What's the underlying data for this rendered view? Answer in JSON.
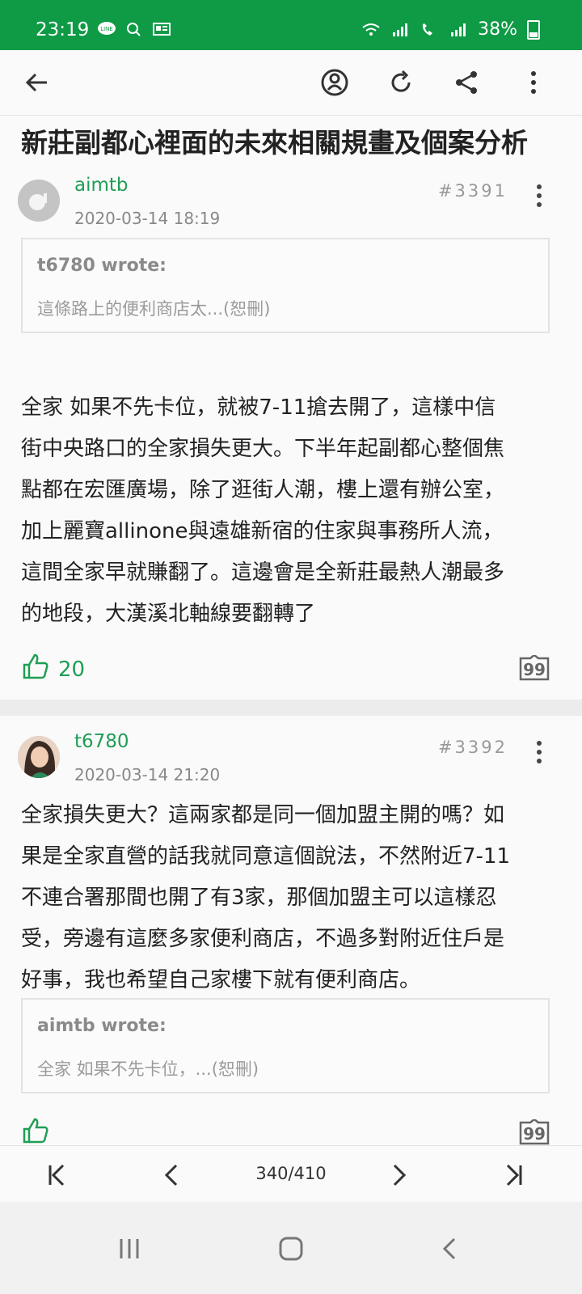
{
  "status_bar": {
    "time": "23:19",
    "battery": "38%",
    "left_icons": [
      "line-app-icon",
      "search-icon",
      "news-icon"
    ],
    "right_icons": [
      "wifi-icon",
      "signal-icon",
      "volte-call-icon",
      "signal-icon",
      "battery-icon"
    ]
  },
  "app_bar": {
    "icons": [
      "back-arrow-icon",
      "author-filter-icon",
      "refresh-icon",
      "share-icon",
      "more-vert-icon"
    ]
  },
  "thread": {
    "title": "新莊副都心裡面的未來相關規畫及個案分析"
  },
  "posts": [
    {
      "author": "aimtb",
      "date": "2020-03-14 18:19",
      "floor": "#3391",
      "quote": {
        "author": "t6780 wrote:",
        "text": "這條路上的便利商店太...(恕刪)"
      },
      "body_lines": [
        "全家 如果不先卡位，就被7-11搶去開了，這樣中信",
        "街中央路口的全家損失更大。下半年起副都心整個焦",
        "點都在宏匯廣場，除了逛街人潮，樓上還有辦公室，",
        "加上麗寶allinone與遠雄新宿的住家與事務所人流，",
        "這間全家早就賺翻了。這邊會是全新莊最熱人潮最多",
        "的地段，大漢溪北軸線要翻轉了"
      ],
      "likes": "20"
    },
    {
      "author": "t6780",
      "date": "2020-03-14 21:20",
      "floor": "#3392",
      "body_lines": [
        "全家損失更大？這兩家都是同一個加盟主開的嗎？如",
        "果是全家直營的話我就同意這個說法，不然附近7-11",
        "不連合署那間也開了有3家，那個加盟主可以這樣忍",
        "受，旁邊有這麼多家便利商店，不過多對附近住戶是",
        "好事，我也希望自己家樓下就有便利商店。"
      ],
      "quote": {
        "author": "aimtb wrote:",
        "text": "全家 如果不先卡位，...(恕刪)"
      }
    }
  ],
  "pager": {
    "label": "340/410"
  },
  "colors": {
    "status_bar": "#0f9a46",
    "accent_green": "#1f9e55"
  }
}
